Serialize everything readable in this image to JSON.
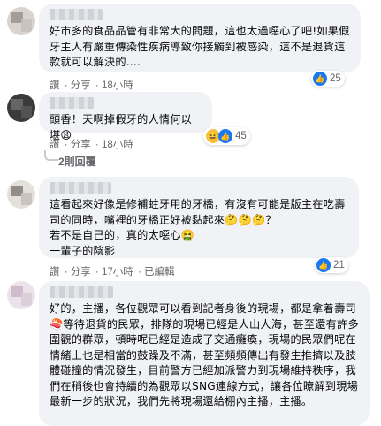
{
  "comments": [
    {
      "text": "好市多的食品品管有非常大的問題，這也太過噁心了吧!如果假牙主人有嚴重傳染性疾病導致你接觸到被感染，這不是退貨這款就可以解決的....",
      "actions": {
        "like": "讚",
        "reply": "分享",
        "time": "18小時"
      },
      "reactions": {
        "count": "25",
        "icons": [
          "like-icon"
        ]
      }
    },
    {
      "text": "頭香！天啊掉假牙的人情何以堪😩",
      "actions": {
        "like": "讚",
        "reply": "分享",
        "time": "18小時"
      },
      "reactions": {
        "count": "45",
        "icons": [
          "haha-icon",
          "like-icon"
        ]
      },
      "replies": "2則回覆"
    },
    {
      "text": "這看起來好像是修補蛀牙用的牙橋，有沒有可能是版主在吃壽司的同時，嘴裡的牙橋正好被黏起來🤔🤔🤔？\n若不是自己的，真的太噁心🤮\n一輩子的陰影",
      "actions": {
        "like": "讚",
        "reply": "分享",
        "time": "17小時",
        "edited": "已編輯"
      },
      "reactions": {
        "count": "21",
        "icons": [
          "like-icon"
        ]
      }
    },
    {
      "text": "好的，主播，各位觀眾可以看到記者身後的現場，都是拿着壽司🍣等待退貨的民眾，排隊的現場已經是人山人海，甚至還有許多圍觀的群眾，頓時呢已經是造成了交通癱瘓，現場的民眾們呢在情緒上也是相當的鼓躁及不滿，甚至頻頻傳出有發生推擠以及肢體碰撞的情況發生，目前警方已經加派警力到現場維持秩序，我們在稍後也會持續的為觀眾以SNG連線方式，讓各位瞭解到現場最新一步的狀況，我們先將現場還給棚內主播，主播。"
    }
  ]
}
